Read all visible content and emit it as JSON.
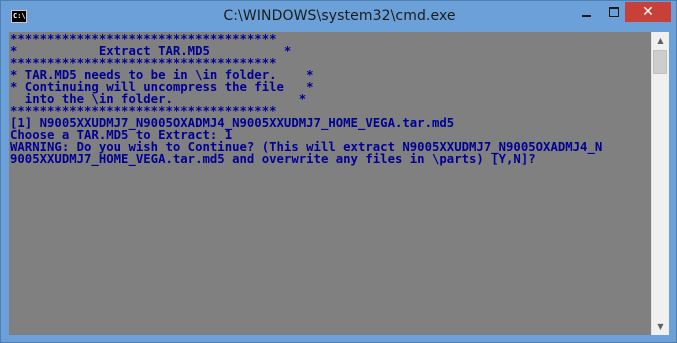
{
  "window": {
    "title": "C:\\WINDOWS\\system32\\cmd.exe",
    "icon_text": "C:\\",
    "controls": {
      "minimize": "minimize-icon",
      "maximize": "maximize-icon",
      "close": "✕"
    }
  },
  "console": {
    "colors": {
      "background": "#808080",
      "text": "#000096"
    },
    "lines": [
      "************************************",
      "*           Extract TAR.MD5          *",
      "************************************",
      "* TAR.MD5 needs to be in \\in folder.    *",
      "* Continuing will uncompress the file   *",
      "  into the \\in folder.                 *",
      "************************************",
      "[1] N9005XXUDMJ7_N9005OXADMJ4_N9005XXUDMJ7_HOME_VEGA.tar.md5",
      "Choose a TAR.MD5 to Extract: 1",
      "WARNING: Do you wish to Continue? (This will extract N9005XXUDMJ7_N9005OXADMJ4_N",
      "9005XXUDMJ7_HOME_VEGA.tar.md5 and overwrite any files in \\parts) [Y,N]?"
    ]
  }
}
